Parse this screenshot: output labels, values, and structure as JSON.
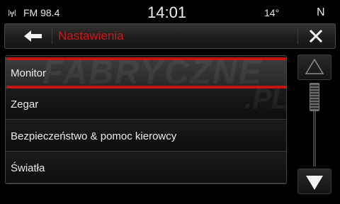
{
  "status": {
    "radio_icon": "radio-signal-icon",
    "radio": "FM 98.4",
    "time": "14:01",
    "temperature": "14°",
    "compass": "N"
  },
  "header": {
    "back_icon": "back-arrow-icon",
    "title": "Nastawienia",
    "close_icon": "close-icon"
  },
  "menu": {
    "items": [
      {
        "label": "Monitor",
        "selected": true
      },
      {
        "label": "Zegar"
      },
      {
        "label": "Bezpieczeństwo & pomoc kierowcy"
      },
      {
        "label": "Światła"
      }
    ]
  },
  "scroll": {
    "up_icon": "scroll-up-icon",
    "down_icon": "scroll-down-icon",
    "position_fraction": 0.0
  },
  "watermark": {
    "logo_text": "FABRYCZNE",
    "logo_suffix": ".PL"
  },
  "colors": {
    "accent_red": "#c41414",
    "title_red": "#d01818",
    "background": "#000000"
  }
}
